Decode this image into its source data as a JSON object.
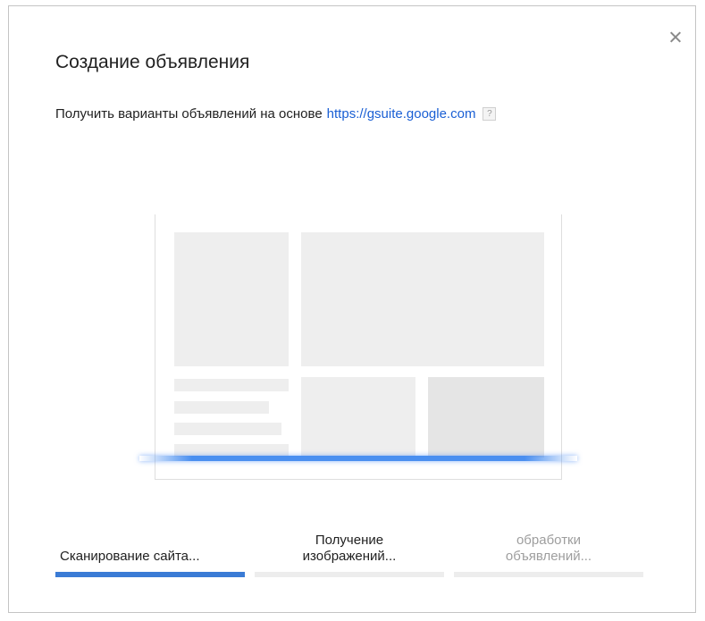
{
  "dialog": {
    "title": "Создание объявления",
    "subtitle_prefix": "Получить варианты объявлений на основе",
    "url": "https://gsuite.google.com",
    "help_glyph": "?",
    "close_icon": "close-icon"
  },
  "steps": [
    {
      "label": "Сканирование сайта...",
      "state": "active",
      "progress": 1.0
    },
    {
      "label": "Получение изображений...",
      "state": "pending",
      "progress": 0.0
    },
    {
      "label": "обработки объявлений...",
      "state": "pending",
      "progress": 0.0
    }
  ],
  "colors": {
    "link": "#1a5fd4",
    "progress_active": "#3a7bd5",
    "progress_inactive": "#ededed",
    "scan_line": "#4a8ff0"
  }
}
